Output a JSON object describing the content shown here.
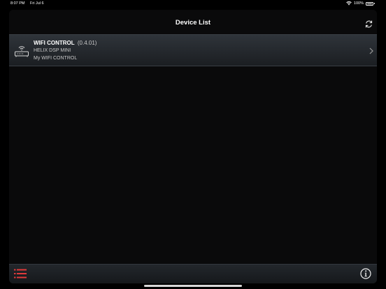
{
  "status_bar": {
    "time": "8:07 PM",
    "date": "Fri Jul 6",
    "battery": "100%"
  },
  "nav": {
    "title": "Device List",
    "refresh_icon": "refresh-icon"
  },
  "devices": [
    {
      "name": "WIFI CONTROL",
      "version": "(0.4.01)",
      "model": "HELIX DSP MINI",
      "label": "My WIFI CONTROL",
      "icon": "router-icon"
    }
  ],
  "toolbar": {
    "list_icon": "list-icon",
    "info_icon": "info-icon",
    "accent_color": "#e03a3a"
  }
}
